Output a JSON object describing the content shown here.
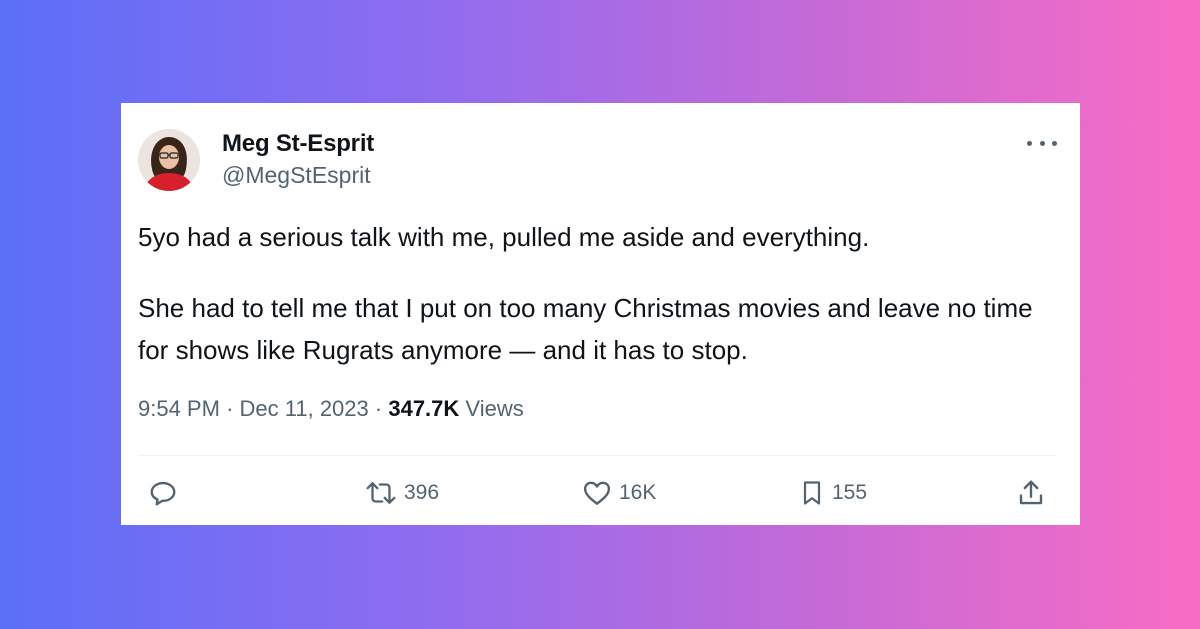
{
  "tweet": {
    "author_name": "Meg St-Esprit",
    "handle": "@MegStEsprit",
    "text_paragraph_1": "5yo had a serious talk with me, pulled me aside and everything.",
    "text_paragraph_2": "She had to tell me that I put on too many Christmas movies and leave no time for shows like Rugrats anymore — and it has to stop.",
    "time": "9:54 PM",
    "date": "Dec 11, 2023",
    "separator": "·",
    "views_count": "347.7K",
    "views_label": "Views"
  },
  "actions": {
    "reply": {
      "icon": "reply-icon",
      "count": ""
    },
    "retweet": {
      "icon": "retweet-icon",
      "count": "396"
    },
    "like": {
      "icon": "heart-icon",
      "count": "16K"
    },
    "bookmark": {
      "icon": "bookmark-icon",
      "count": "155"
    },
    "share": {
      "icon": "share-icon",
      "count": ""
    }
  },
  "colors": {
    "text_primary": "#0f1419",
    "text_secondary": "#536471",
    "card_bg": "#ffffff",
    "gradient_start": "#5b6ff7",
    "gradient_end": "#f86cc3"
  }
}
